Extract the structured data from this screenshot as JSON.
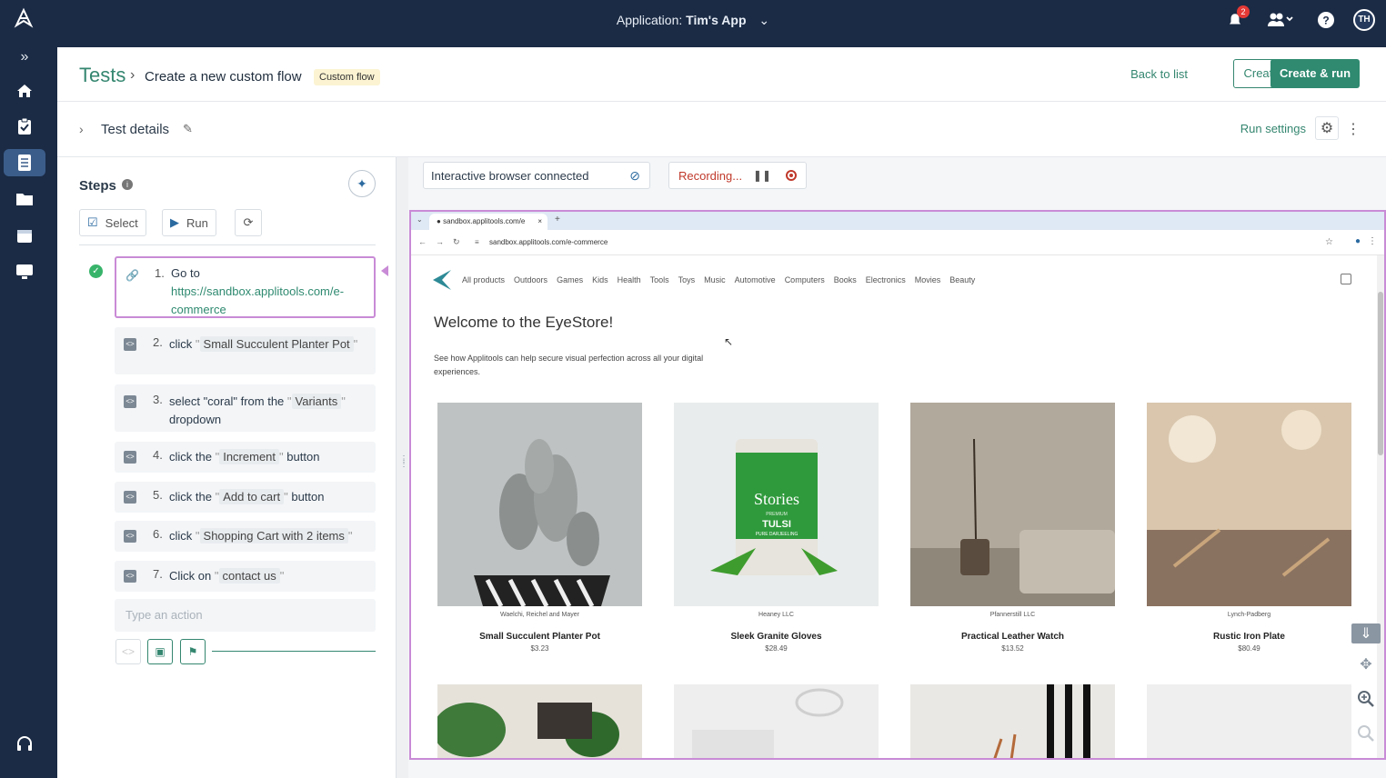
{
  "topbar": {
    "app_label": "Application:",
    "app_name": "Tim's App",
    "notif_count": "2",
    "avatar_initials": "TH"
  },
  "breadcrumb": {
    "root": "Tests",
    "title": "Create a new custom flow",
    "tag": "Custom flow"
  },
  "actions": {
    "back": "Back to list",
    "create": "Create",
    "create_run": "Create & run"
  },
  "details": {
    "label": "Test details",
    "run_settings": "Run settings"
  },
  "steps": {
    "title": "Steps",
    "select": "Select",
    "run": "Run",
    "items": [
      {
        "num": "1.",
        "action": "Go to",
        "target": "https://sandbox.applitools.com/e-commerce"
      },
      {
        "num": "2.",
        "action": "click",
        "target": "Small Succulent Planter Pot"
      },
      {
        "num": "3.",
        "action": "select \"coral\" from the",
        "target": "Variants",
        "suffix": "dropdown"
      },
      {
        "num": "4.",
        "action": "click the",
        "target": "Increment",
        "suffix": "button"
      },
      {
        "num": "5.",
        "action": "click the",
        "target": "Add to cart",
        "suffix": "button"
      },
      {
        "num": "6.",
        "action": "click",
        "target": "Shopping Cart with 2 items"
      },
      {
        "num": "7.",
        "action": "Click on",
        "target": "contact us"
      }
    ],
    "placeholder": "Type an action"
  },
  "status": {
    "connected": "Interactive browser connected",
    "recording": "Recording..."
  },
  "browser": {
    "tab": "sandbox.applitools.com/e",
    "url": "sandbox.applitools.com/e-commerce",
    "nav": [
      "All products",
      "Outdoors",
      "Games",
      "Kids",
      "Health",
      "Tools",
      "Toys",
      "Music",
      "Automotive",
      "Computers",
      "Books",
      "Electronics",
      "Movies",
      "Beauty"
    ],
    "welcome": "Welcome to the EyeStore!",
    "subtitle": "See how Applitools can help secure visual perfection across all your digital experiences.",
    "products": [
      {
        "vendor": "Waelchi, Reichel and Mayer",
        "name": "Small Succulent Planter Pot",
        "price": "$3.23"
      },
      {
        "vendor": "Heaney LLC",
        "name": "Sleek Granite Gloves",
        "price": "$28.49"
      },
      {
        "vendor": "Pfannerstill LLC",
        "name": "Practical Leather Watch",
        "price": "$13.52"
      },
      {
        "vendor": "Lynch-Padberg",
        "name": "Rustic Iron Plate",
        "price": "$80.49"
      }
    ],
    "bag_brand": "Stories",
    "bag_sub": "PREMIUM",
    "bag_name": "TULSI",
    "bag_flavor": "PURE DARJEELING"
  },
  "colors": {
    "nav_bg": "#1b2b45",
    "accent": "#2f8a70",
    "recording": "#c0392b",
    "highlight": "#c98bd6"
  }
}
